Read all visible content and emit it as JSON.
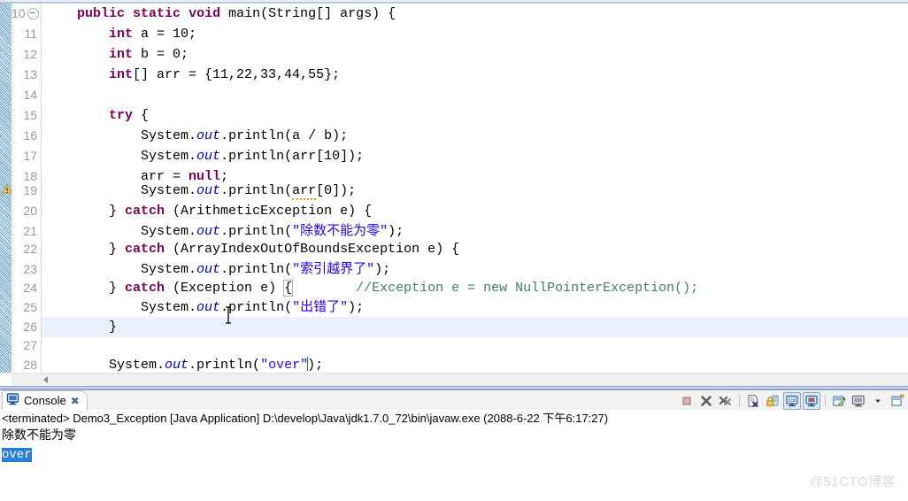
{
  "editor": {
    "first_line": 10,
    "highlighted_line": 26,
    "warning_line": 19,
    "lines": [
      {
        "n": "10",
        "fold": true
      },
      {
        "n": "11"
      },
      {
        "n": "12"
      },
      {
        "n": "13"
      },
      {
        "n": "14"
      },
      {
        "n": "15"
      },
      {
        "n": "16"
      },
      {
        "n": "17"
      },
      {
        "n": "18"
      },
      {
        "n": "19"
      },
      {
        "n": "20"
      },
      {
        "n": "21"
      },
      {
        "n": "22"
      },
      {
        "n": "23"
      },
      {
        "n": "24"
      },
      {
        "n": "25"
      },
      {
        "n": "26"
      },
      {
        "n": "27"
      },
      {
        "n": "28"
      }
    ],
    "code": {
      "l10_kw1": "public",
      "l10_kw2": "static",
      "l10_kw3": "void",
      "l10_rest": " main(String[] args) {",
      "l11_kw": "int",
      "l11_rest": " a = 10;",
      "l12_kw": "int",
      "l12_rest": " b = 0;",
      "l13_kw": "int",
      "l13_rest": "[] arr = {11,22,33,44,55};",
      "l14": "",
      "l15_kw": "try",
      "l15_rest": " {",
      "l16_pre": "System.",
      "l16_fld": "out",
      "l16_post": ".println(a / b);",
      "l17_pre": "System.",
      "l17_fld": "out",
      "l17_post": ".println(arr[10]);",
      "l18_pre": "arr = ",
      "l18_kw": "null",
      "l18_post": ";",
      "l19_pre": "System.",
      "l19_fld": "out",
      "l19_mid": ".println(",
      "l19_warn": "arr",
      "l19_post": "[0]);",
      "l20_pre": "} ",
      "l20_kw": "catch",
      "l20_post": " (ArithmeticException e) {",
      "l21_pre": "System.",
      "l21_fld": "out",
      "l21_mid": ".println(",
      "l21_str": "\"除数不能为零\"",
      "l21_post": ");",
      "l22_pre": "} ",
      "l22_kw": "catch",
      "l22_post": " (ArrayIndexOutOfBoundsException e) {",
      "l23_pre": "System.",
      "l23_fld": "out",
      "l23_mid": ".println(",
      "l23_str": "\"索引越界了\"",
      "l23_post": ");",
      "l24_pre": "} ",
      "l24_kw": "catch",
      "l24_mid": " (Exception e) ",
      "l24_brace": "{",
      "l24_gap": "        ",
      "l24_cmt": "//Exception e = new NullPointerException();",
      "l25_pre": "System.",
      "l25_fld": "out",
      "l25_mid": ".println(",
      "l25_str": "\"出错了\"",
      "l25_post": ");",
      "l26": "}",
      "l27": "",
      "l28_pre": "System.",
      "l28_fld": "out",
      "l28_mid": ".println(",
      "l28_str": "\"over\"",
      "l28_post": ");"
    }
  },
  "console": {
    "tab_label": "Console",
    "tab_close_glyph": "✖",
    "toolbar": [
      {
        "name": "terminate-button",
        "title": "Terminate"
      },
      {
        "name": "remove-launch-button",
        "title": "Remove Launch"
      },
      {
        "name": "remove-all-terminated-button",
        "title": "Remove All Terminated Launches"
      },
      {
        "name": "clear-console-button",
        "title": "Clear Console"
      },
      {
        "name": "scroll-lock-button",
        "title": "Scroll Lock"
      },
      {
        "name": "pin-console-button",
        "title": "Pin Console"
      },
      {
        "name": "display-selected-console-button",
        "title": "Display Selected Console"
      },
      {
        "name": "open-console-button",
        "title": "Open Console"
      },
      {
        "name": "new-console-view-button",
        "title": "New Console View"
      }
    ],
    "status_line": "<terminated> Demo3_Exception [Java Application] D:\\develop\\Java\\jdk1.7.0_72\\bin\\javaw.exe (2088-6-22 下午6:17:27)",
    "output_lines": [
      {
        "text": "除数不能为零",
        "selected": false
      },
      {
        "text": "over",
        "selected": true
      }
    ]
  },
  "watermark": {
    "text": "@51CTO博客"
  },
  "colors": {
    "keyword": "#7f0055",
    "string": "#2a00ff",
    "comment": "#3f7f5f",
    "field": "#0000c0",
    "line_number": "#999999",
    "current_line_highlight": "#eaf1fc",
    "selection": "#2a7fd4",
    "annotation_ruler": "#5b9bd5"
  }
}
